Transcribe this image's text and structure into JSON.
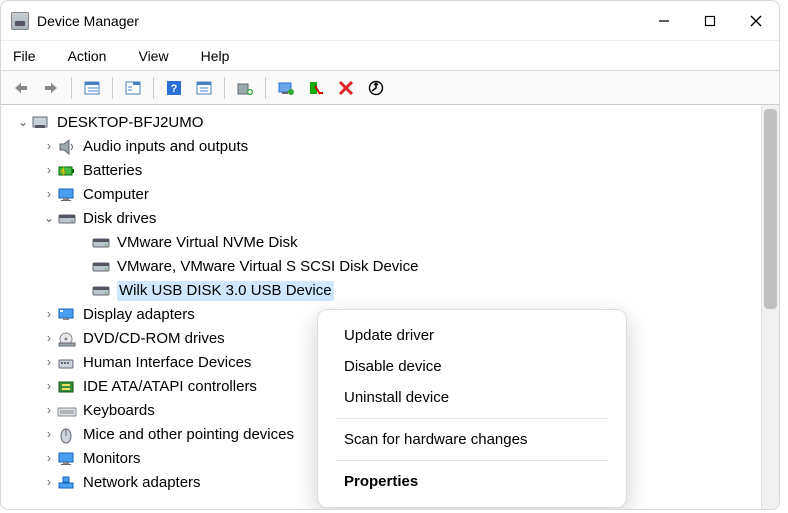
{
  "window": {
    "title": "Device Manager"
  },
  "menubar": {
    "items": [
      "File",
      "Action",
      "View",
      "Help"
    ]
  },
  "toolbar": {
    "icons": [
      "back",
      "forward",
      "show-hidden",
      "properties-pane",
      "help",
      "properties",
      "update-driver",
      "uninstall",
      "disable",
      "delete",
      "scan"
    ]
  },
  "tree": {
    "root": {
      "label": "DESKTOP-BFJ2UMO",
      "expanded": true
    },
    "categories": [
      {
        "label": "Audio inputs and outputs",
        "icon": "speaker",
        "expanded": false,
        "hasChildren": true
      },
      {
        "label": "Batteries",
        "icon": "battery",
        "expanded": false,
        "hasChildren": true
      },
      {
        "label": "Computer",
        "icon": "monitor",
        "expanded": false,
        "hasChildren": true
      },
      {
        "label": "Disk drives",
        "icon": "disk",
        "expanded": true,
        "hasChildren": true,
        "children": [
          {
            "label": "VMware Virtual NVMe Disk",
            "icon": "disk"
          },
          {
            "label": "VMware, VMware Virtual S SCSI Disk Device",
            "icon": "disk"
          },
          {
            "label": "Wilk USB DISK 3.0 USB Device",
            "icon": "disk",
            "selected": true
          }
        ]
      },
      {
        "label": "Display adapters",
        "icon": "display",
        "expanded": false,
        "hasChildren": true
      },
      {
        "label": "DVD/CD-ROM drives",
        "icon": "optical",
        "expanded": false,
        "hasChildren": true
      },
      {
        "label": "Human Interface Devices",
        "icon": "hid",
        "expanded": false,
        "hasChildren": true
      },
      {
        "label": "IDE ATA/ATAPI controllers",
        "icon": "ide",
        "expanded": false,
        "hasChildren": true
      },
      {
        "label": "Keyboards",
        "icon": "keyboard",
        "expanded": false,
        "hasChildren": true
      },
      {
        "label": "Mice and other pointing devices",
        "icon": "mouse",
        "expanded": false,
        "hasChildren": true
      },
      {
        "label": "Monitors",
        "icon": "monitor",
        "expanded": false,
        "hasChildren": true
      },
      {
        "label": "Network adapters",
        "icon": "network",
        "expanded": false,
        "hasChildren": true
      }
    ]
  },
  "contextMenu": {
    "items": [
      {
        "label": "Update driver",
        "type": "item"
      },
      {
        "label": "Disable device",
        "type": "item"
      },
      {
        "label": "Uninstall device",
        "type": "item"
      },
      {
        "type": "sep"
      },
      {
        "label": "Scan for hardware changes",
        "type": "item"
      },
      {
        "type": "sep"
      },
      {
        "label": "Properties",
        "type": "item",
        "bold": true
      }
    ]
  }
}
